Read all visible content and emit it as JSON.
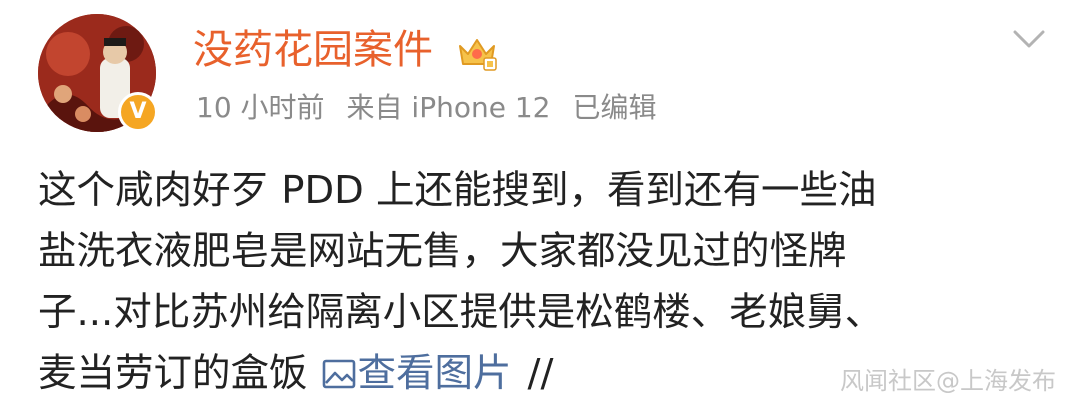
{
  "author": {
    "name": "没药花园案件",
    "verified_badge": "V",
    "vip_icon": "crown-vip-icon"
  },
  "meta": {
    "time": "10 小时前",
    "source": "来自 iPhone 12",
    "edited": "已编辑"
  },
  "post": {
    "lines": [
      "这个咸肉好歹 PDD 上还能搜到，看到还有一些油",
      "盐洗衣液肥皂是网站无售，大家都没见过的怪牌",
      "子...对比苏州给隔离小区提供是松鹤楼、老娘舅、",
      "麦当劳订的盒饭"
    ],
    "view_images_label": "查看图片",
    "separator": "//"
  },
  "watermark": "风闻社区@上海发布",
  "colors": {
    "username": "#e8612c",
    "meta": "#8a8a8a",
    "body_text": "#222222",
    "link": "#4e6e9e",
    "badge": "#f5a623"
  }
}
